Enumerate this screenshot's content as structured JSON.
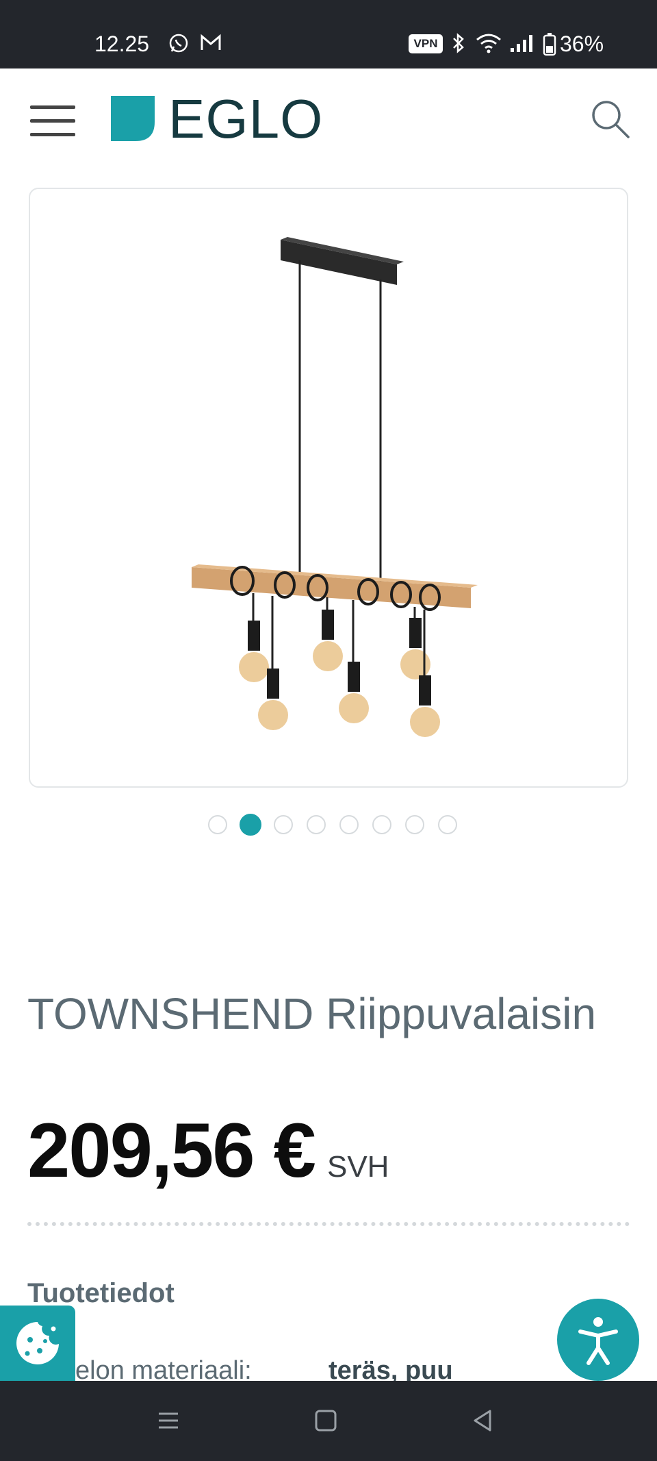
{
  "status_bar": {
    "time": "12.25",
    "vpn": "VPN",
    "battery": "36%",
    "icons": [
      "whatsapp-icon",
      "gmail-icon",
      "bluetooth-icon",
      "wifi-icon",
      "signal-icon",
      "battery-icon"
    ]
  },
  "header": {
    "logo_text": "EGLO",
    "brand_color": "#1aa0a8",
    "icons": [
      "hamburger-menu-icon",
      "search-icon"
    ]
  },
  "carousel": {
    "total": 8,
    "active_index": 1
  },
  "product": {
    "title": "TOWNSHEND Riippuvalaisin",
    "price": "209,56 €",
    "price_suffix": "SVH"
  },
  "details": {
    "section_title": "Tuotetiedot",
    "rows": [
      {
        "label": "elon materiaali:",
        "value": "teräs, puu"
      }
    ]
  },
  "floating": {
    "cookie_icon": "cookie-icon",
    "accessibility_icon": "accessibility-icon"
  },
  "nav": {
    "icons": [
      "recents-icon",
      "home-icon",
      "back-icon"
    ]
  }
}
